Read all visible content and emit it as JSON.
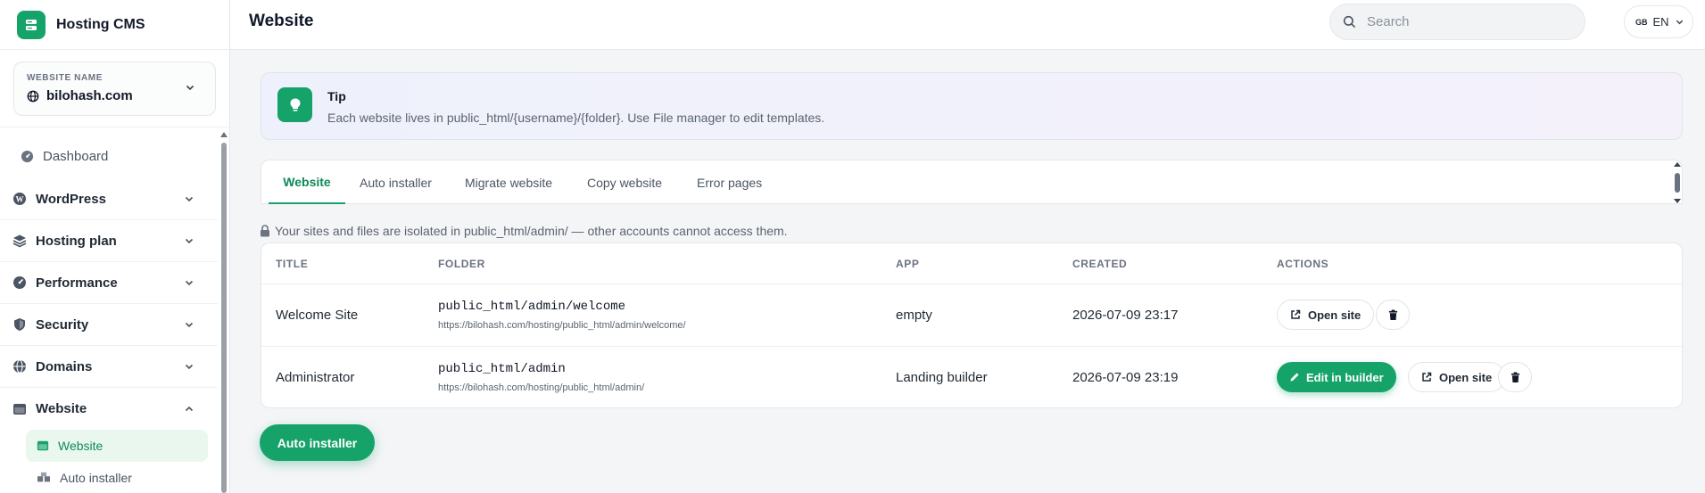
{
  "app": {
    "name": "Hosting CMS"
  },
  "site_selector": {
    "label": "WEBSITE NAME",
    "value": "bilohash.com"
  },
  "sidebar": {
    "dashboard": "Dashboard",
    "items": [
      {
        "label": "WordPress",
        "icon": "wordpress-icon"
      },
      {
        "label": "Hosting plan",
        "icon": "layers-icon"
      },
      {
        "label": "Performance",
        "icon": "gauge-icon"
      },
      {
        "label": "Security",
        "icon": "shield-icon"
      },
      {
        "label": "Domains",
        "icon": "globe-icon"
      },
      {
        "label": "Website",
        "icon": "browser-icon",
        "expanded": true
      }
    ],
    "sub_items": [
      {
        "label": "Website",
        "active": true
      },
      {
        "label": "Auto installer",
        "active": false
      }
    ]
  },
  "header": {
    "title": "Website",
    "search_placeholder": "Search",
    "language": {
      "flag": "GB",
      "code": "EN"
    }
  },
  "tip": {
    "title": "Tip",
    "text": "Each website lives in public_html/{username}/{folder}. Use File manager to edit templates."
  },
  "tabs": [
    "Website",
    "Auto installer",
    "Migrate website",
    "Copy website",
    "Error pages"
  ],
  "active_tab": "Website",
  "isolation_note": "Your sites and files are isolated in public_html/admin/ — other accounts cannot access them.",
  "table": {
    "columns": [
      "TITLE",
      "FOLDER",
      "APP",
      "CREATED",
      "ACTIONS"
    ],
    "rows": [
      {
        "title": "Welcome Site",
        "folder": "public_html/admin/welcome",
        "url": "https://bilohash.com/hosting/public_html/admin/welcome/",
        "app": "empty",
        "created": "2026-07-09 23:17",
        "actions": {
          "open": "Open site"
        }
      },
      {
        "title": "Administrator",
        "folder": "public_html/admin",
        "url": "https://bilohash.com/hosting/public_html/admin/",
        "app": "Landing builder",
        "created": "2026-07-09 23:19",
        "actions": {
          "edit": "Edit in builder",
          "open": "Open site"
        }
      }
    ]
  },
  "fab_label": "Auto installer",
  "colors": {
    "accent": "#16a36a",
    "accent_light": "#e9f7ef",
    "text": "#1f2933"
  }
}
